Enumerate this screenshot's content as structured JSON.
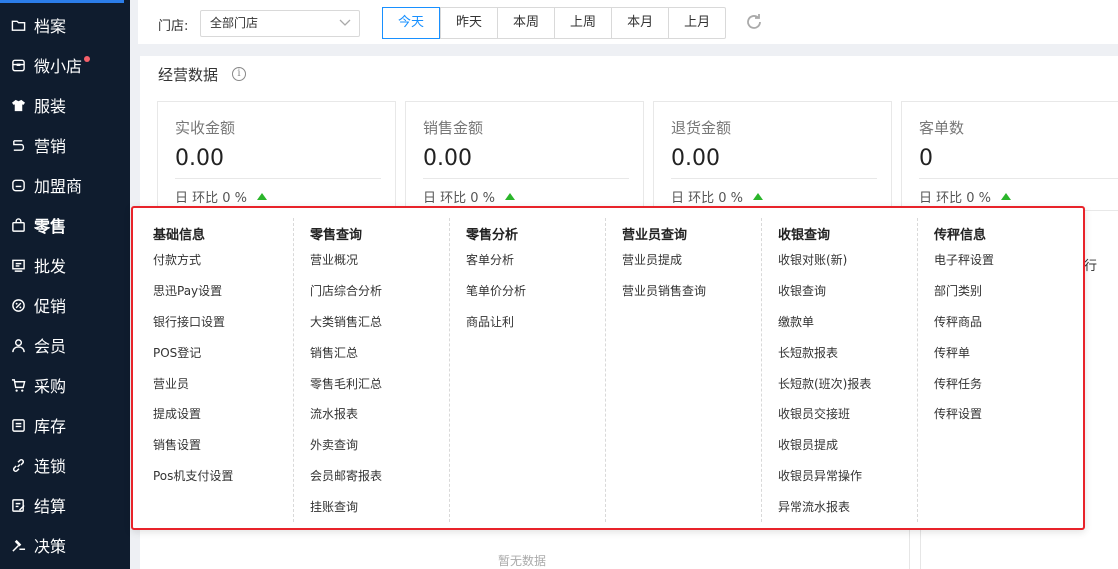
{
  "sidebar": {
    "items": [
      {
        "label": "档案",
        "icon": "folder-icon"
      },
      {
        "label": "微小店",
        "icon": "shop-icon",
        "badge": true
      },
      {
        "label": "服装",
        "icon": "shirt-icon"
      },
      {
        "label": "营销",
        "icon": "marketing-icon"
      },
      {
        "label": "加盟商",
        "icon": "franchise-icon"
      },
      {
        "label": "零售",
        "icon": "bag-icon"
      },
      {
        "label": "批发",
        "icon": "wholesale-icon"
      },
      {
        "label": "促销",
        "icon": "promotion-icon"
      },
      {
        "label": "会员",
        "icon": "user-icon"
      },
      {
        "label": "采购",
        "icon": "cart-icon"
      },
      {
        "label": "库存",
        "icon": "inventory-icon"
      },
      {
        "label": "连锁",
        "icon": "link-icon"
      },
      {
        "label": "结算",
        "icon": "settlement-icon"
      },
      {
        "label": "决策",
        "icon": "decision-icon"
      }
    ]
  },
  "filter": {
    "store_label": "门店:",
    "store_value": "全部门店",
    "ranges": [
      "今天",
      "昨天",
      "本周",
      "上周",
      "本月",
      "上月"
    ],
    "active_range": "今天"
  },
  "panel": {
    "title": "经营数据",
    "cards": [
      {
        "label": "实收金额",
        "value": "0.00",
        "compare": "日 环比 0 %"
      },
      {
        "label": "销售金额",
        "value": "0.00",
        "compare": "日 环比 0 %"
      },
      {
        "label": "退货金额",
        "value": "0.00",
        "compare": "日 环比 0 %"
      },
      {
        "label": "客单数",
        "value": "0",
        "compare": "日 环比 0 %"
      }
    ],
    "peek_text": "行",
    "no_data": "暂无数据"
  },
  "menu": {
    "columns": [
      {
        "title": "基础信息",
        "items": [
          "付款方式",
          "思迅Pay设置",
          "银行接口设置",
          "POS登记",
          "营业员",
          "提成设置",
          "销售设置",
          "Pos机支付设置"
        ]
      },
      {
        "title": "零售查询",
        "items": [
          "营业概况",
          "门店综合分析",
          "大类销售汇总",
          "销售汇总",
          "零售毛利汇总",
          "流水报表",
          "外卖查询",
          "会员邮寄报表",
          "挂账查询"
        ]
      },
      {
        "title": "零售分析",
        "items": [
          "客单分析",
          "笔单价分析",
          "商品让利"
        ]
      },
      {
        "title": "营业员查询",
        "items": [
          "营业员提成",
          "营业员销售查询"
        ]
      },
      {
        "title": "收银查询",
        "items": [
          "收银对账(新)",
          "收银查询",
          "缴款单",
          "长短款报表",
          "长短款(班次)报表",
          "收银员交接班",
          "收银员提成",
          "收银员异常操作",
          "异常流水报表"
        ]
      },
      {
        "title": "传秤信息",
        "items": [
          "电子秤设置",
          "部门类别",
          "传秤商品",
          "传秤单",
          "传秤任务",
          "传秤设置"
        ]
      }
    ]
  },
  "colors": {
    "sidebar_bg": "#0f1c2e",
    "accent": "#1890ff",
    "highlight_border": "#e8232a",
    "up_arrow": "#2bb52b",
    "badge": "#f5606a"
  }
}
